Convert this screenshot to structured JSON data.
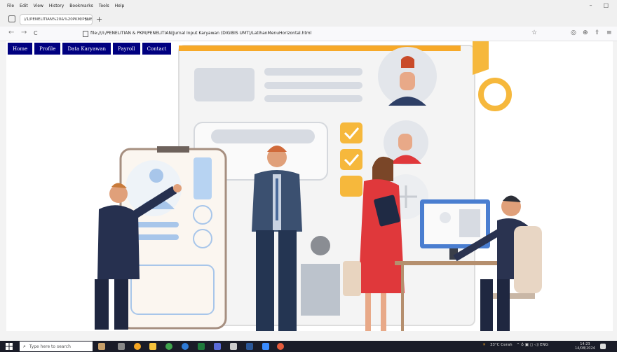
{
  "browser": {
    "menu": [
      "File",
      "Edit",
      "View",
      "History",
      "Bookmarks",
      "Tools",
      "Help"
    ],
    "window_controls": [
      "–",
      "□"
    ],
    "tab_title": "//1/PENELITIAN%20&%20PKM/PENE",
    "tab_close": "×",
    "new_tab": "+",
    "nav": {
      "back": "←",
      "forward": "→",
      "reload": "C"
    },
    "url": "file:///I:/PENELITIAN & PKM/PENELITIAN/Jurnal Input Karyawan (DIGIBIS UMT)/LatihanMenuHorizontal.html",
    "right_icons": [
      "☆",
      "◎",
      "⊕",
      "⇧",
      "≡"
    ]
  },
  "site_menu": [
    "Home",
    "Profile",
    "Data Karyawan",
    "Payroll",
    "Contact"
  ],
  "taskbar": {
    "search_placeholder": "Type here to search",
    "weather": "33°C Cerah",
    "tray_text": "^ ♁ ▣ ◻ ◁) ENG",
    "time": "14:23",
    "date": "14/08/2024"
  },
  "colors": {
    "menu_bg": "#000080",
    "menu_text": "#ffffff",
    "taskbar_bg": "#1a1c28"
  }
}
